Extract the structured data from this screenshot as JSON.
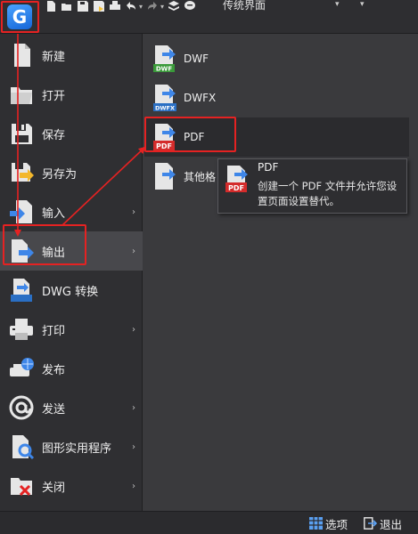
{
  "quick_access": {
    "workspace": "传统界面"
  },
  "menu": {
    "items": [
      {
        "label": "新建",
        "chevron": ""
      },
      {
        "label": "打开",
        "chevron": ""
      },
      {
        "label": "保存",
        "chevron": ""
      },
      {
        "label": "另存为",
        "chevron": ""
      },
      {
        "label": "输入",
        "chevron": "›"
      },
      {
        "label": "输出",
        "chevron": "›"
      },
      {
        "label": "DWG 转换",
        "chevron": ""
      },
      {
        "label": "打印",
        "chevron": "›"
      },
      {
        "label": "发布",
        "chevron": ""
      },
      {
        "label": "发送",
        "chevron": "›"
      },
      {
        "label": "图形实用程序",
        "chevron": "›"
      },
      {
        "label": "关闭",
        "chevron": "›"
      }
    ]
  },
  "submenu": {
    "items": [
      {
        "label": "DWF",
        "icon_text": "DWF"
      },
      {
        "label": "DWFX",
        "icon_text": "DWFX"
      },
      {
        "label": "PDF",
        "icon_text": "PDF"
      },
      {
        "label": "其他格",
        "icon_text": ""
      }
    ]
  },
  "tooltip": {
    "title": "PDF",
    "description": "创建一个 PDF 文件并允许您设置页面设置替代。",
    "icon_text": "PDF"
  },
  "bottombar": {
    "options_label": "选项",
    "exit_label": "退出"
  },
  "colors": {
    "accent_red": "#e52222",
    "logo_blue": "#1e7ae6",
    "dwf_green": "#3a9a3a",
    "dwfx_blue": "#2a6fc4",
    "pdf_red": "#d42b2b"
  },
  "icons": {
    "logo": "gstarcad-logo-icon",
    "new": "new-file-icon",
    "open": "open-folder-icon",
    "save": "save-disk-icon",
    "saveas": "save-as-icon",
    "import": "import-icon",
    "export": "export-icon",
    "dwg_convert": "dwg-convert-icon",
    "print": "printer-icon",
    "publish": "publish-icon",
    "send": "send-at-icon",
    "utilities": "drawing-utilities-icon",
    "close": "close-file-icon"
  }
}
